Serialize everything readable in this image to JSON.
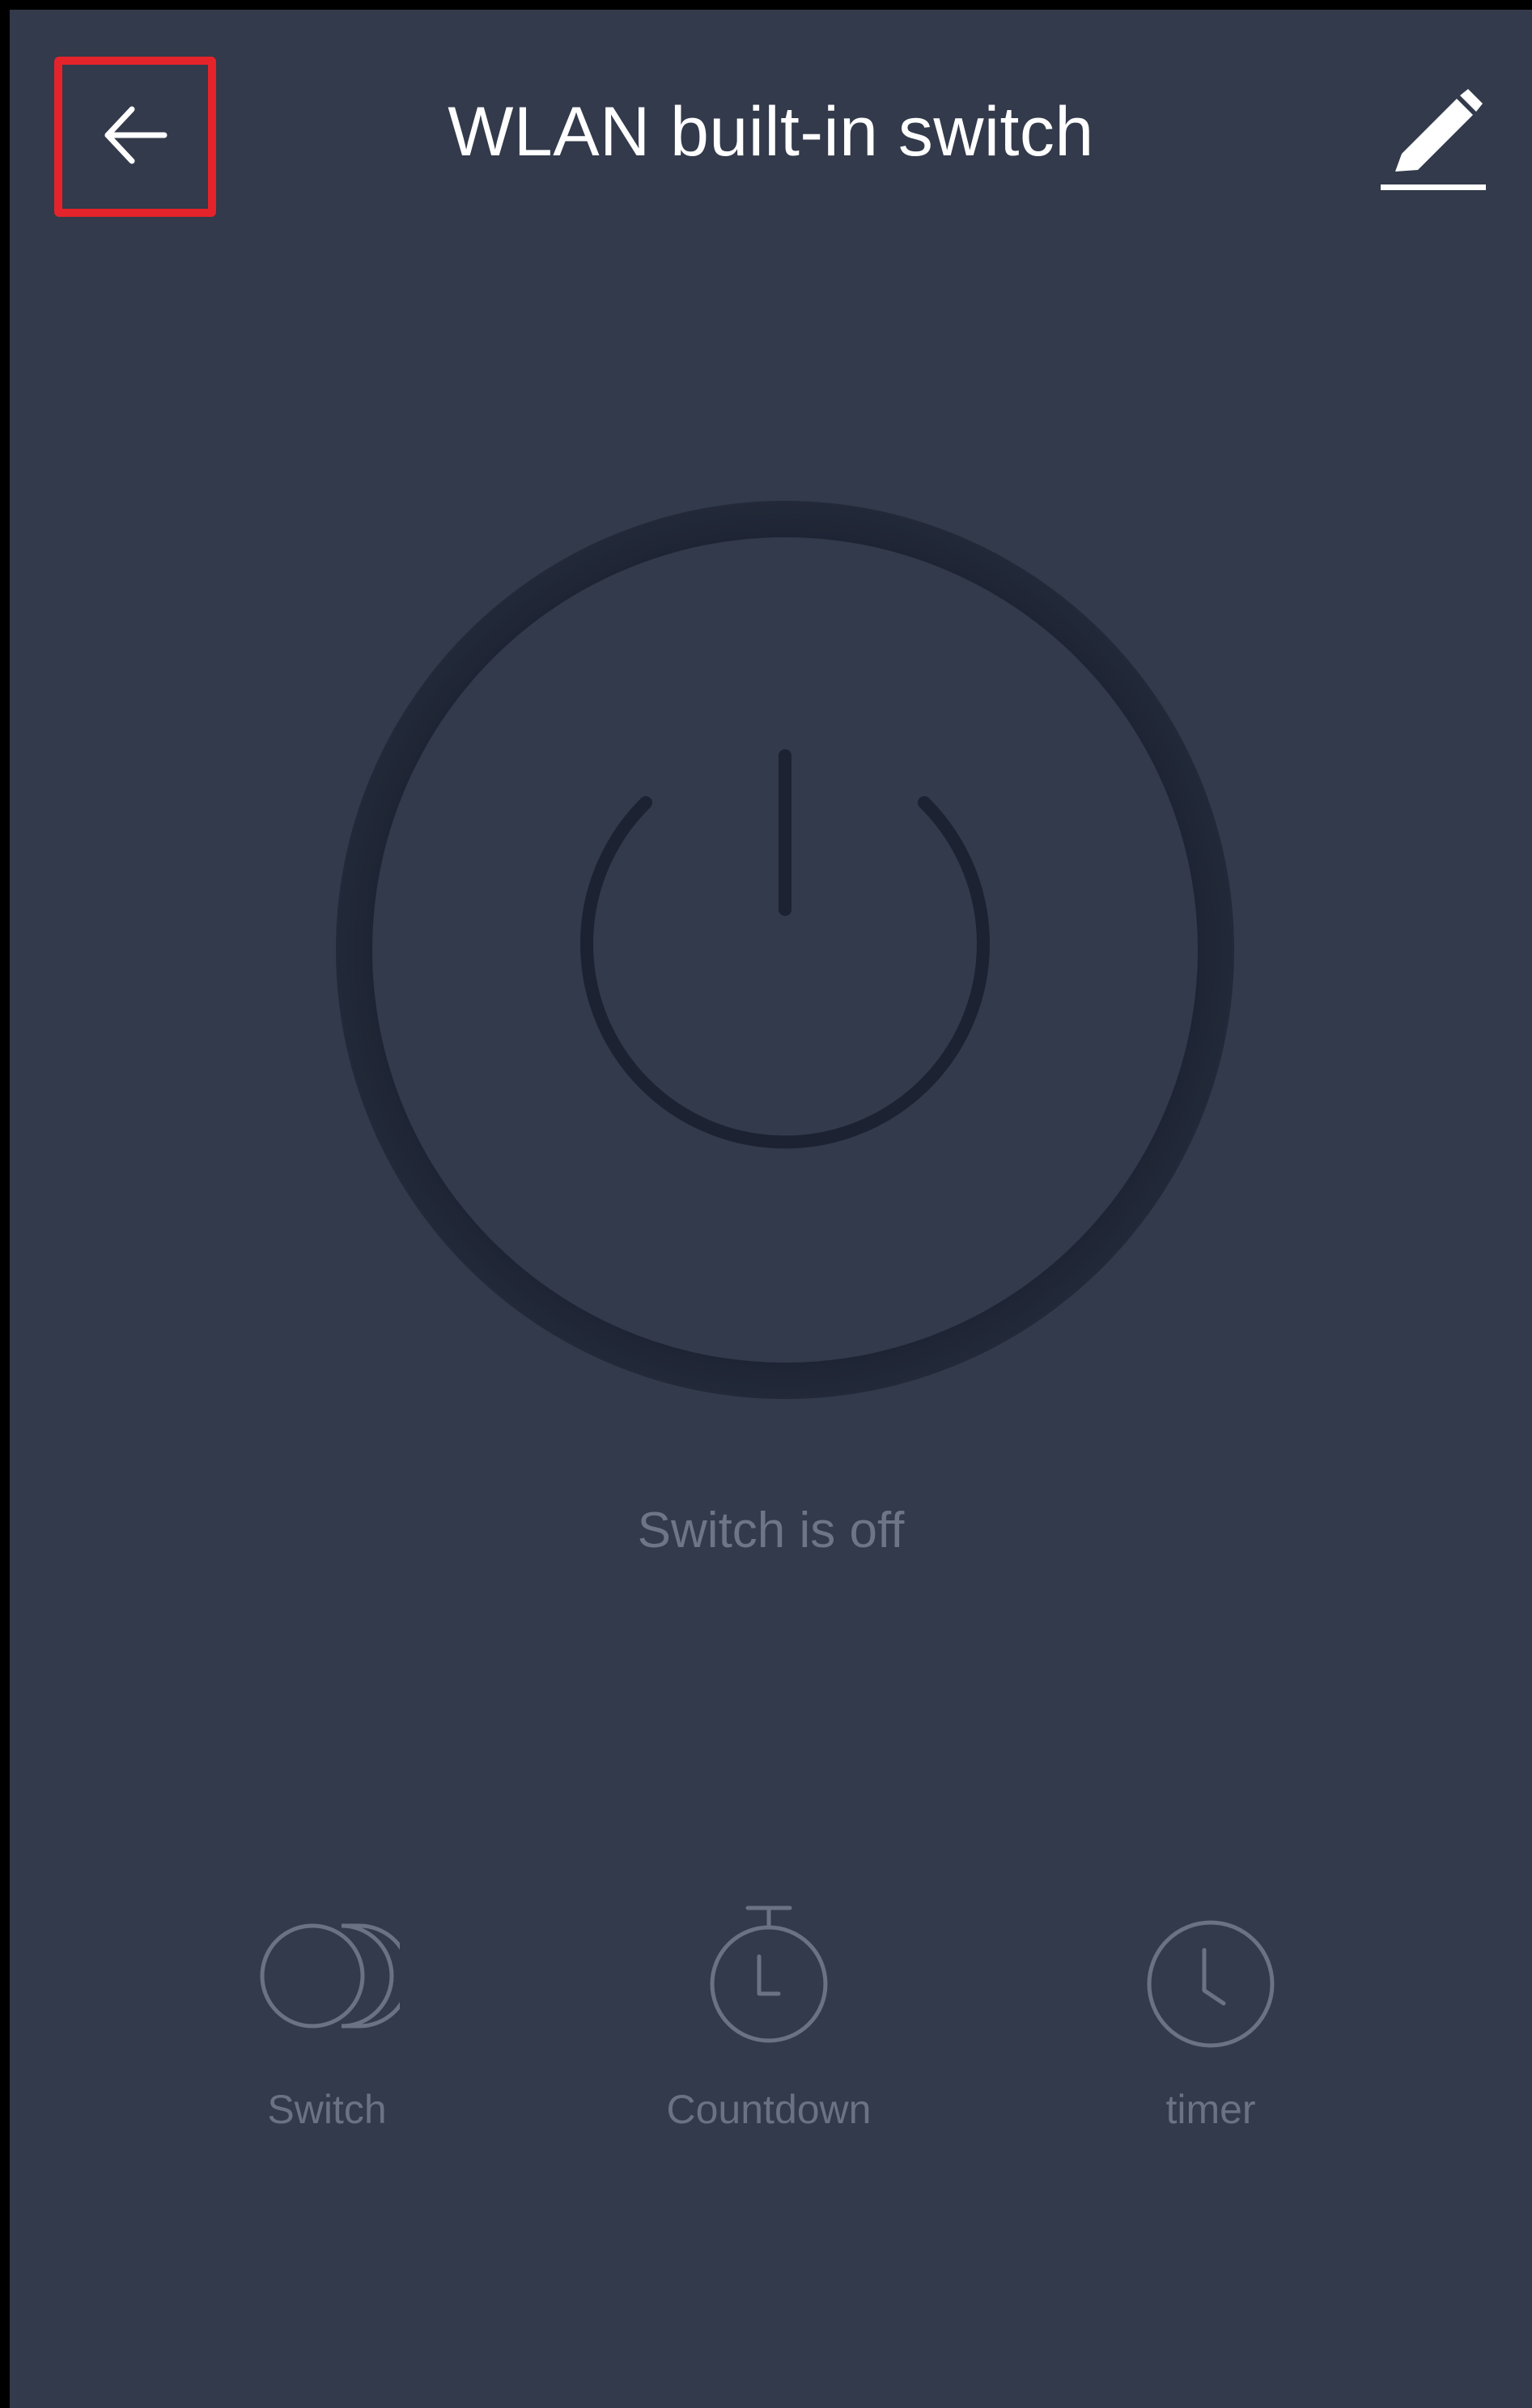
{
  "header": {
    "title": "WLAN built-in switch",
    "back_icon": "arrow-left-icon",
    "edit_icon": "pencil-icon"
  },
  "power": {
    "icon": "power-icon",
    "state": "off"
  },
  "status": {
    "text": "Switch is off"
  },
  "actions": [
    {
      "label": "Switch",
      "icon": "switch-toggle-icon"
    },
    {
      "label": "Countdown",
      "icon": "stopwatch-icon"
    },
    {
      "label": "timer",
      "icon": "clock-icon"
    }
  ],
  "colors": {
    "background": "#323a4b",
    "ring": "#1c2231",
    "highlight_box": "#e5232a",
    "title": "#ffffff",
    "muted_text": "#6d7587"
  }
}
